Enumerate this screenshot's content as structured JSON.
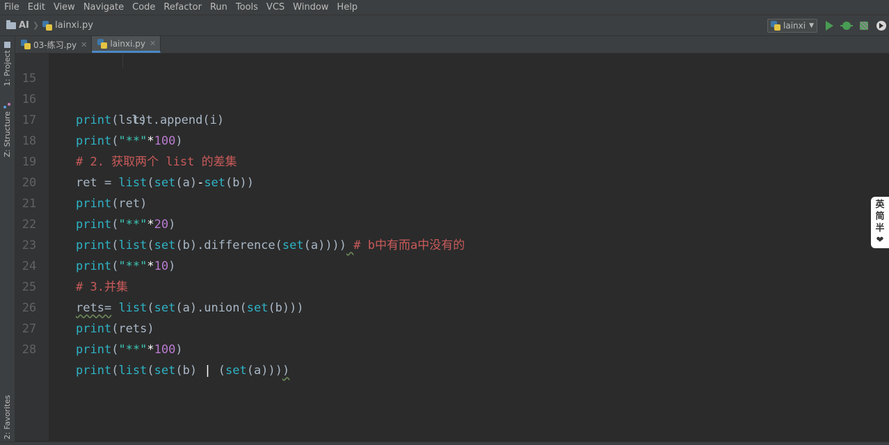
{
  "menu": [
    "File",
    "Edit",
    "View",
    "Navigate",
    "Code",
    "Refactor",
    "Run",
    "Tools",
    "VCS",
    "Window",
    "Help"
  ],
  "breadcrumb": {
    "project": "AI",
    "file": "lainxi.py"
  },
  "run_config": {
    "name": "lainxi"
  },
  "tool_windows": {
    "project": "1: Project",
    "structure": "Z: Structure",
    "favorites": "2: Favorites"
  },
  "tabs": [
    {
      "label": "03-练习.py",
      "active": false
    },
    {
      "label": "lainxi.py",
      "active": true
    }
  ],
  "code_lines": [
    {
      "n": "15",
      "text": "lst.append(i)"
    },
    {
      "n": "16",
      "text": "print(lst)"
    },
    {
      "n": "17",
      "text": "print(\"**\"*100)"
    },
    {
      "n": "18",
      "text": "# 2. 获取两个 list 的差集"
    },
    {
      "n": "19",
      "text": "ret = list(set(a)-set(b))"
    },
    {
      "n": "20",
      "text": "print(ret)"
    },
    {
      "n": "21",
      "text": "print(\"**\"*20)"
    },
    {
      "n": "22",
      "text": "print(list(set(b).difference(set(a)))) # b中有而a中没有的"
    },
    {
      "n": "23",
      "text": "print(\"**\"*10)"
    },
    {
      "n": "24",
      "text": "# 3.并集"
    },
    {
      "n": "25",
      "text": "rets= list(set(a).union(set(b)))"
    },
    {
      "n": "26",
      "text": "print(rets)"
    },
    {
      "n": "27",
      "text": "print(\"**\"*100)"
    },
    {
      "n": "28",
      "text": "print(list(set(b) | (set(a))))"
    }
  ],
  "ime": [
    "英",
    "简",
    "半",
    "❤"
  ]
}
